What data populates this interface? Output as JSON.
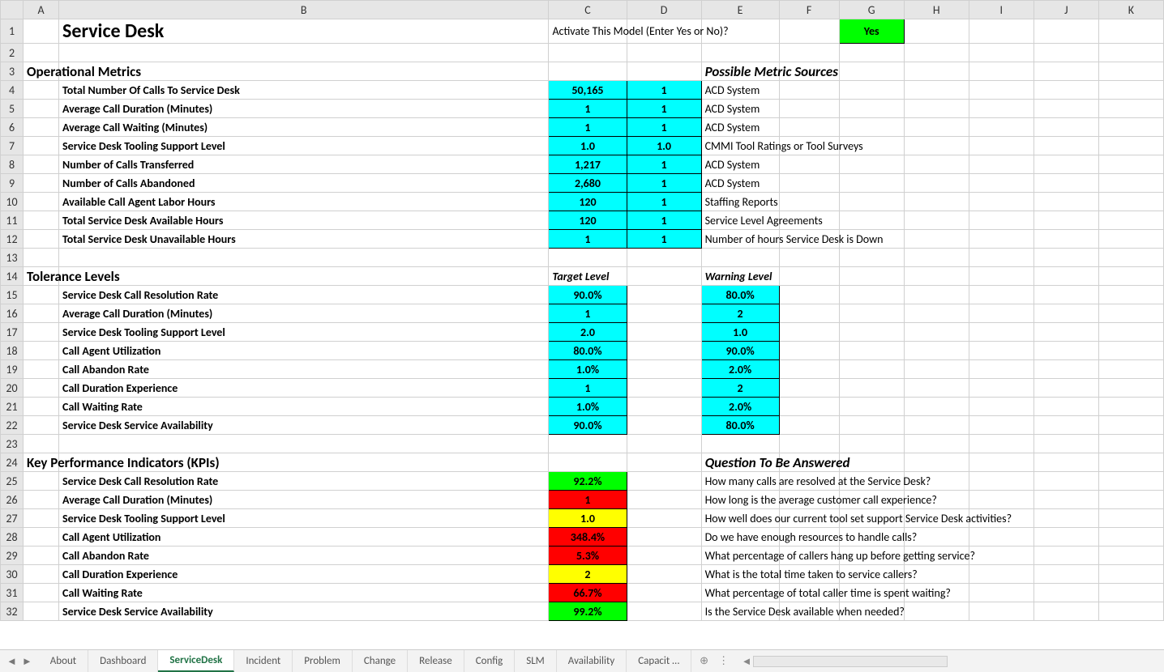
{
  "cols": [
    "A",
    "B",
    "C",
    "D",
    "E",
    "F",
    "G",
    "H",
    "I",
    "J",
    "K"
  ],
  "title": "Service Desk",
  "activate_prompt": "Activate This Model (Enter Yes or No)?",
  "activate_value": "Yes",
  "sections": {
    "operational_metrics": "Operational Metrics",
    "possible_sources": "Possible Metric Sources",
    "tolerance_levels": "Tolerance Levels",
    "target_level": "Target Level",
    "warning_level": "Warning Level",
    "kpis": "Key Performance Indicators (KPIs)",
    "question": "Question To Be Answered"
  },
  "metrics": [
    {
      "label": "Total Number Of Calls To Service Desk",
      "c": "50,165",
      "d": "1",
      "src": "ACD System"
    },
    {
      "label": "Average Call Duration (Minutes)",
      "c": "1",
      "d": "1",
      "src": "ACD System"
    },
    {
      "label": "Average Call Waiting (Minutes)",
      "c": "1",
      "d": "1",
      "src": "ACD System"
    },
    {
      "label": "Service Desk Tooling Support Level",
      "c": "1.0",
      "d": "1.0",
      "src": "CMMI Tool Ratings or Tool Surveys"
    },
    {
      "label": "Number of Calls Transferred",
      "c": "1,217",
      "d": "1",
      "src": "ACD System"
    },
    {
      "label": "Number of Calls Abandoned",
      "c": "2,680",
      "d": "1",
      "src": "ACD System"
    },
    {
      "label": "Available Call Agent Labor Hours",
      "c": "120",
      "d": "1",
      "src": "Staffing Reports"
    },
    {
      "label": "Total Service Desk Available Hours",
      "c": "120",
      "d": "1",
      "src": "Service Level Agreements"
    },
    {
      "label": "Total Service Desk Unavailable Hours",
      "c": "1",
      "d": "1",
      "src": "Number of hours Service Desk is Down"
    }
  ],
  "tolerance": [
    {
      "label": "Service Desk Call Resolution Rate",
      "target": "90.0%",
      "warn": "80.0%"
    },
    {
      "label": "Average Call Duration (Minutes)",
      "target": "1",
      "warn": "2"
    },
    {
      "label": "Service Desk Tooling Support Level",
      "target": "2.0",
      "warn": "1.0"
    },
    {
      "label": "Call Agent Utilization",
      "target": "80.0%",
      "warn": "90.0%"
    },
    {
      "label": "Call Abandon Rate",
      "target": "1.0%",
      "warn": "2.0%"
    },
    {
      "label": "Call Duration Experience",
      "target": "1",
      "warn": "2"
    },
    {
      "label": "Call Waiting Rate",
      "target": "1.0%",
      "warn": "2.0%"
    },
    {
      "label": "Service Desk Service Availability",
      "target": "90.0%",
      "warn": "80.0%"
    }
  ],
  "kpi": [
    {
      "label": "Service Desk Call Resolution Rate",
      "val": "92.2%",
      "cls": "green-cell",
      "q": "How many calls are resolved at the Service Desk?"
    },
    {
      "label": "Average Call Duration (Minutes)",
      "val": "1",
      "cls": "red-cell",
      "q": "How long is the average customer call experience?"
    },
    {
      "label": "Service Desk Tooling Support Level",
      "val": "1.0",
      "cls": "yellow-cell",
      "q": "How well does our current tool set support Service Desk activities?"
    },
    {
      "label": "Call Agent Utilization",
      "val": "348.4%",
      "cls": "red-cell",
      "q": "Do we have enough resources to handle calls?"
    },
    {
      "label": "Call Abandon Rate",
      "val": "5.3%",
      "cls": "red-cell",
      "q": "What percentage of callers hang up before getting service?"
    },
    {
      "label": "Call Duration Experience",
      "val": "2",
      "cls": "yellow-cell",
      "q": "What is the total time taken to service callers?"
    },
    {
      "label": "Call Waiting Rate",
      "val": "66.7%",
      "cls": "red-cell",
      "q": "What percentage of total caller time is spent waiting?"
    },
    {
      "label": "Service Desk Service Availability",
      "val": "99.2%",
      "cls": "green-cell",
      "q": "Is the Service Desk available when needed?"
    }
  ],
  "tabs": [
    "About",
    "Dashboard",
    "ServiceDesk",
    "Incident",
    "Problem",
    "Change",
    "Release",
    "Config",
    "SLM",
    "Availability",
    "Capacit …"
  ],
  "active_tab": "ServiceDesk"
}
